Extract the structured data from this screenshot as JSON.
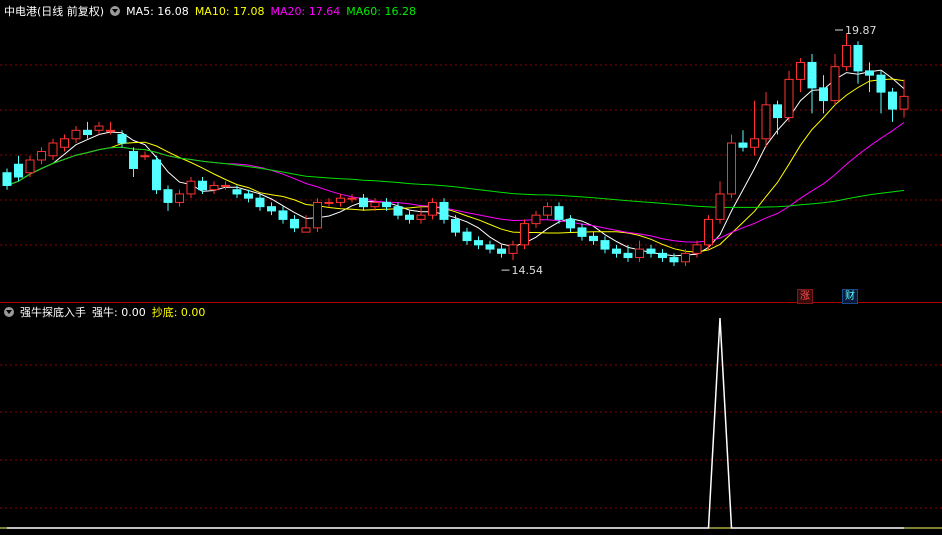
{
  "header": {
    "stock_title": "中电港(日线 前复权)",
    "ma5_label": "MA5: 16.08",
    "ma10_label": "MA10: 17.08",
    "ma20_label": "MA20: 17.64",
    "ma60_label": "MA60: 16.28"
  },
  "indicator": {
    "title": "强牛探底入手",
    "strong_label": "强牛: 0.00",
    "bottom_label": "抄底: 0.00"
  },
  "badges": {
    "rise": "涨",
    "finance": "财"
  },
  "colors": {
    "background": "#000000",
    "up": "#ff3232",
    "down": "#54ffff",
    "ma5": "#ffffff",
    "ma10": "#ffff00",
    "ma20": "#ff00ff",
    "ma60": "#00e000",
    "grid": "#8b0000",
    "signal": "#ffffff"
  },
  "chart_data": [
    {
      "type": "candlestick",
      "title": "中电港(日线 前复权)",
      "ylim": [
        13.6,
        20.2
      ],
      "annotations": [
        {
          "label": "19.87",
          "index": 72,
          "value": 19.87,
          "kind": "max"
        },
        {
          "label": "14.54",
          "index": 43,
          "value": 14.54,
          "kind": "min"
        }
      ],
      "candles": [
        [
          16.6,
          16.3,
          16.7,
          16.2
        ],
        [
          16.8,
          16.5,
          17.0,
          16.4
        ],
        [
          16.6,
          16.9,
          17.0,
          16.5
        ],
        [
          16.9,
          17.1,
          17.2,
          16.8
        ],
        [
          17.0,
          17.3,
          17.4,
          16.9
        ],
        [
          17.2,
          17.4,
          17.5,
          17.1
        ],
        [
          17.4,
          17.6,
          17.7,
          17.3
        ],
        [
          17.6,
          17.5,
          17.8,
          17.4
        ],
        [
          17.6,
          17.7,
          17.8,
          17.5
        ],
        [
          17.6,
          17.6,
          17.8,
          17.5
        ],
        [
          17.5,
          17.3,
          17.6,
          17.2
        ],
        [
          17.1,
          16.7,
          17.2,
          16.5
        ],
        [
          17.0,
          17.0,
          17.1,
          16.9
        ],
        [
          16.9,
          16.2,
          17.0,
          16.1
        ],
        [
          16.2,
          15.9,
          16.3,
          15.7
        ],
        [
          15.9,
          16.1,
          16.2,
          15.8
        ],
        [
          16.1,
          16.4,
          16.5,
          16.0
        ],
        [
          16.4,
          16.2,
          16.5,
          16.1
        ],
        [
          16.2,
          16.3,
          16.4,
          16.1
        ],
        [
          16.3,
          16.3,
          16.4,
          16.2
        ],
        [
          16.2,
          16.1,
          16.3,
          16.0
        ],
        [
          16.1,
          16.0,
          16.2,
          15.9
        ],
        [
          16.0,
          15.8,
          16.1,
          15.7
        ],
        [
          15.8,
          15.7,
          15.9,
          15.6
        ],
        [
          15.7,
          15.5,
          15.8,
          15.4
        ],
        [
          15.5,
          15.3,
          15.6,
          15.2
        ],
        [
          15.2,
          15.3,
          15.6,
          15.2
        ],
        [
          15.3,
          15.9,
          16.0,
          15.2
        ],
        [
          15.9,
          15.9,
          16.0,
          15.8
        ],
        [
          15.9,
          16.0,
          16.1,
          15.8
        ],
        [
          16.0,
          16.0,
          16.1,
          15.9
        ],
        [
          16.0,
          15.8,
          16.1,
          15.7
        ],
        [
          15.8,
          15.9,
          16.0,
          15.7
        ],
        [
          15.9,
          15.8,
          16.0,
          15.7
        ],
        [
          15.8,
          15.6,
          15.9,
          15.5
        ],
        [
          15.6,
          15.5,
          15.7,
          15.4
        ],
        [
          15.5,
          15.6,
          15.8,
          15.4
        ],
        [
          15.6,
          15.9,
          16.0,
          15.5
        ],
        [
          15.9,
          15.5,
          16.0,
          15.4
        ],
        [
          15.5,
          15.2,
          15.6,
          15.1
        ],
        [
          15.2,
          15.0,
          15.3,
          14.9
        ],
        [
          15.0,
          14.9,
          15.1,
          14.8
        ],
        [
          14.9,
          14.8,
          15.0,
          14.7
        ],
        [
          14.8,
          14.7,
          14.9,
          14.6
        ],
        [
          14.7,
          14.9,
          15.0,
          14.54
        ],
        [
          14.9,
          15.4,
          15.5,
          14.8
        ],
        [
          15.4,
          15.6,
          15.7,
          15.3
        ],
        [
          15.6,
          15.8,
          15.9,
          15.5
        ],
        [
          15.8,
          15.5,
          15.9,
          15.4
        ],
        [
          15.5,
          15.3,
          15.6,
          15.2
        ],
        [
          15.3,
          15.1,
          15.4,
          15.0
        ],
        [
          15.1,
          15.0,
          15.2,
          14.9
        ],
        [
          15.0,
          14.8,
          15.1,
          14.7
        ],
        [
          14.8,
          14.7,
          14.9,
          14.6
        ],
        [
          14.7,
          14.6,
          14.9,
          14.5
        ],
        [
          14.6,
          14.8,
          15.0,
          14.5
        ],
        [
          14.8,
          14.7,
          14.9,
          14.6
        ],
        [
          14.7,
          14.6,
          14.8,
          14.5
        ],
        [
          14.6,
          14.5,
          14.7,
          14.4
        ],
        [
          14.5,
          14.7,
          14.8,
          14.4
        ],
        [
          14.7,
          14.9,
          15.0,
          14.6
        ],
        [
          14.9,
          15.5,
          15.6,
          14.8
        ],
        [
          15.5,
          16.1,
          16.4,
          15.4
        ],
        [
          16.1,
          17.3,
          17.5,
          16.0
        ],
        [
          17.3,
          17.2,
          17.6,
          17.1
        ],
        [
          17.2,
          17.4,
          18.3,
          17.0
        ],
        [
          17.4,
          18.2,
          18.5,
          17.2
        ],
        [
          18.2,
          17.9,
          18.3,
          17.5
        ],
        [
          17.9,
          18.8,
          19.0,
          17.8
        ],
        [
          18.8,
          19.2,
          19.3,
          18.5
        ],
        [
          19.2,
          18.6,
          19.4,
          18.0
        ],
        [
          18.6,
          18.3,
          18.9,
          18.0
        ],
        [
          18.3,
          19.1,
          19.4,
          18.2
        ],
        [
          19.1,
          19.6,
          19.87,
          19.0
        ],
        [
          19.6,
          19.0,
          19.7,
          18.7
        ],
        [
          19.0,
          18.9,
          19.2,
          18.5
        ],
        [
          18.9,
          18.5,
          19.0,
          18.0
        ],
        [
          18.5,
          18.1,
          18.6,
          17.8
        ],
        [
          18.1,
          18.4,
          18.8,
          17.9
        ]
      ],
      "series": [
        {
          "name": "MA5",
          "color": "#ffffff"
        },
        {
          "name": "MA10",
          "color": "#ffff00"
        },
        {
          "name": "MA20",
          "color": "#ff00ff"
        },
        {
          "name": "MA60",
          "color": "#00e000"
        }
      ]
    },
    {
      "type": "line",
      "title": "强牛探底入手",
      "ylim": [
        0,
        1
      ],
      "series": [
        {
          "name": "强牛",
          "values": [
            0,
            0,
            0,
            0,
            0,
            0,
            0,
            0,
            0,
            0,
            0,
            0,
            0,
            0,
            0,
            0,
            0,
            0,
            0,
            0,
            0,
            0,
            0,
            0,
            0,
            0,
            0,
            0,
            0,
            0,
            0,
            0,
            0,
            0,
            0,
            0,
            0,
            0,
            0,
            0,
            0,
            0,
            0,
            0,
            0,
            0,
            0,
            0,
            0,
            0,
            0,
            0,
            0,
            0,
            0,
            0,
            0,
            0,
            0,
            0,
            0,
            0,
            1,
            0,
            0,
            0,
            0,
            0,
            0,
            0,
            0,
            0,
            0,
            0,
            0,
            0,
            0,
            0,
            0
          ]
        }
      ]
    }
  ]
}
